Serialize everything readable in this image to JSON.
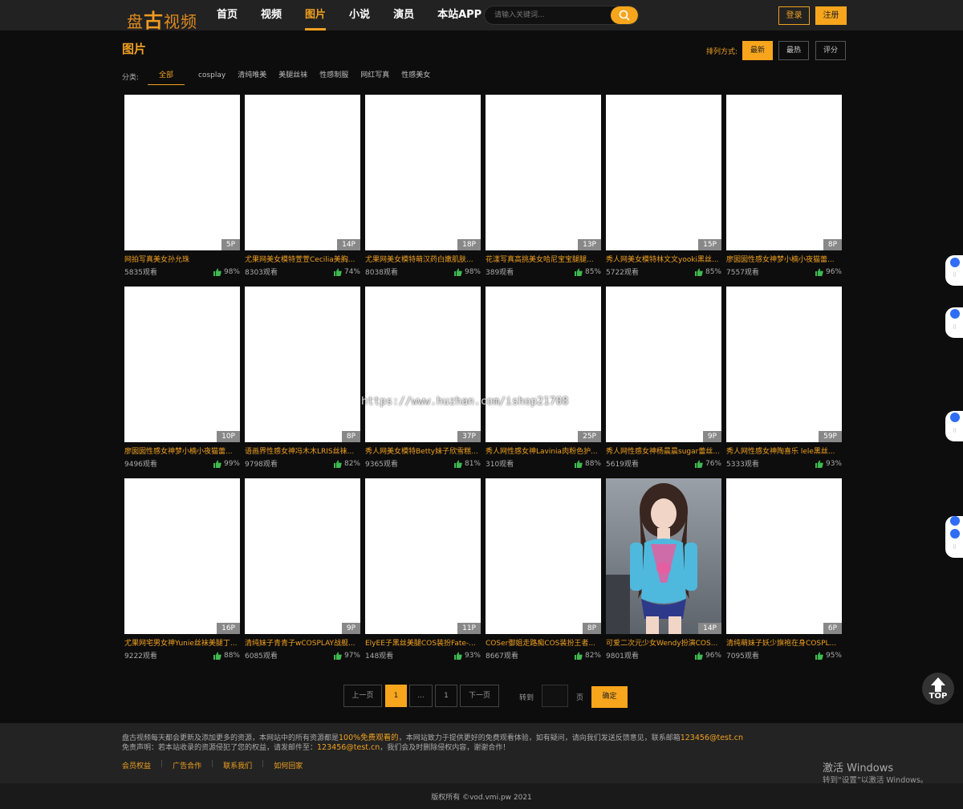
{
  "header": {
    "logo_a": "盘",
    "logo_b": "古",
    "logo_c": "视频",
    "nav": [
      {
        "label": "首页",
        "active": false
      },
      {
        "label": "视频",
        "active": false
      },
      {
        "label": "图片",
        "active": true
      },
      {
        "label": "小说",
        "active": false
      },
      {
        "label": "演员",
        "active": false
      },
      {
        "label": "本站APP",
        "active": false
      }
    ],
    "search_placeholder": "请输入关键词...",
    "search_icon": "search-icon",
    "login": "登录",
    "register": "注册"
  },
  "main": {
    "title": "图片",
    "sort_label": "排列方式:",
    "sort_options": [
      {
        "label": "最新",
        "active": true
      },
      {
        "label": "最热",
        "active": false
      },
      {
        "label": "评分",
        "active": false
      }
    ],
    "category_label": "分类:",
    "categories": [
      {
        "label": "全部",
        "active": true
      },
      {
        "label": "cosplay",
        "active": false
      },
      {
        "label": "清纯唯美",
        "active": false
      },
      {
        "label": "美腿丝袜",
        "active": false
      },
      {
        "label": "性感制服",
        "active": false
      },
      {
        "label": "网红写真",
        "active": false
      },
      {
        "label": "性感美女",
        "active": false
      }
    ]
  },
  "items": [
    {
      "title": "网拍写真美女孙允珠",
      "count": "5P",
      "views": "5835观看",
      "rating": "98%"
    },
    {
      "title": "尤果网美女模特萱萱Cecilia美胸...",
      "count": "14P",
      "views": "8303观看",
      "rating": "74%"
    },
    {
      "title": "尤果网美女模特萌汉药白嫩肌肤...",
      "count": "18P",
      "views": "8038观看",
      "rating": "98%"
    },
    {
      "title": "花漾写真高挑美女哈尼宝宝腿腿...",
      "count": "13P",
      "views": "389观看",
      "rating": "85%"
    },
    {
      "title": "秀人网美女模特林文文yooki黑丝...",
      "count": "15P",
      "views": "5722观看",
      "rating": "85%"
    },
    {
      "title": "廖囡囡性感女神梦小楠小夜猫蕾...",
      "count": "8P",
      "views": "7557观看",
      "rating": "96%"
    },
    {
      "title": "廖囡囡性感女神梦小楠小夜猫蕾...",
      "count": "10P",
      "views": "9496观看",
      "rating": "99%"
    },
    {
      "title": "语画界性感女神冯木木LRIS丝袜...",
      "count": "8P",
      "views": "9798观看",
      "rating": "82%"
    },
    {
      "title": "秀人网美女模特Betty妹子欣雪糕...",
      "count": "37P",
      "views": "9365观看",
      "rating": "81%"
    },
    {
      "title": "秀人网性感女神Lavinia肉粉色护...",
      "count": "25P",
      "views": "310观看",
      "rating": "88%"
    },
    {
      "title": "秀人网性感女神杨晨晨sugar蕾丝...",
      "count": "9P",
      "views": "5619观看",
      "rating": "76%"
    },
    {
      "title": "秀人网性感女神陶喜乐  lele黑丝...",
      "count": "59P",
      "views": "5333观看",
      "rating": "93%"
    },
    {
      "title": "尤果网宅男女神Yunie丝袜美腿丁...",
      "count": "16P",
      "views": "9222观看",
      "rating": "88%"
    },
    {
      "title": "清纯妹子青青子wCOSPLAY战舰...",
      "count": "9P",
      "views": "6085观看",
      "rating": "97%"
    },
    {
      "title": "ElyEE子黑丝美腿COS装扮Fate-...",
      "count": "11P",
      "views": "148观看",
      "rating": "93%"
    },
    {
      "title": "COSer御姐走路痴COS装扮王者...",
      "count": "8P",
      "views": "8667观看",
      "rating": "82%"
    },
    {
      "title": "可爱二次元少女Wendy扮演COS...",
      "count": "14P",
      "views": "9801观看",
      "rating": "96%",
      "photo": true
    },
    {
      "title": "清纯萌妹子妖少旗袍在身COSPL...",
      "count": "6P",
      "views": "7095观看",
      "rating": "95%"
    }
  ],
  "watermark": "https://www.huzhan.com/ishop21708",
  "pagination": {
    "prev": "上一页",
    "current": "1",
    "ellipsis": "...",
    "last": "1",
    "next": "下一页",
    "goto_label": "转到",
    "page_unit": "页",
    "confirm": "确定"
  },
  "footer": {
    "line1_a": "盘古视频每天都会更新及添加更多的资源，本网站中的所有资源都是",
    "line1_hl": "100%免费观看的",
    "line1_b": "，本网站致力于提供更好的免费观看体验，如有疑问，请向我们发送反馈意见，联系邮箱",
    "line1_email": "123456@test.cn",
    "line2_a": "免责声明：若本站收录的资源侵犯了您的权益，请发邮件至：",
    "line2_email": "123456@test.cn",
    "line2_b": "，我们会及时删除侵权内容，谢谢合作！",
    "links": [
      "会员权益",
      "广告合作",
      "联系我们",
      "如何回家"
    ],
    "copyright": "版权所有 ©vod.vmi.pw 2021"
  },
  "windows": {
    "title": "激活 Windows",
    "subtitle": "转到“设置”以激活 Windows。"
  },
  "top_button": "TOP",
  "colors": {
    "accent": "#f7a51c",
    "background": "#0d0d0d",
    "header": "#222222",
    "like": "#3fb950"
  }
}
